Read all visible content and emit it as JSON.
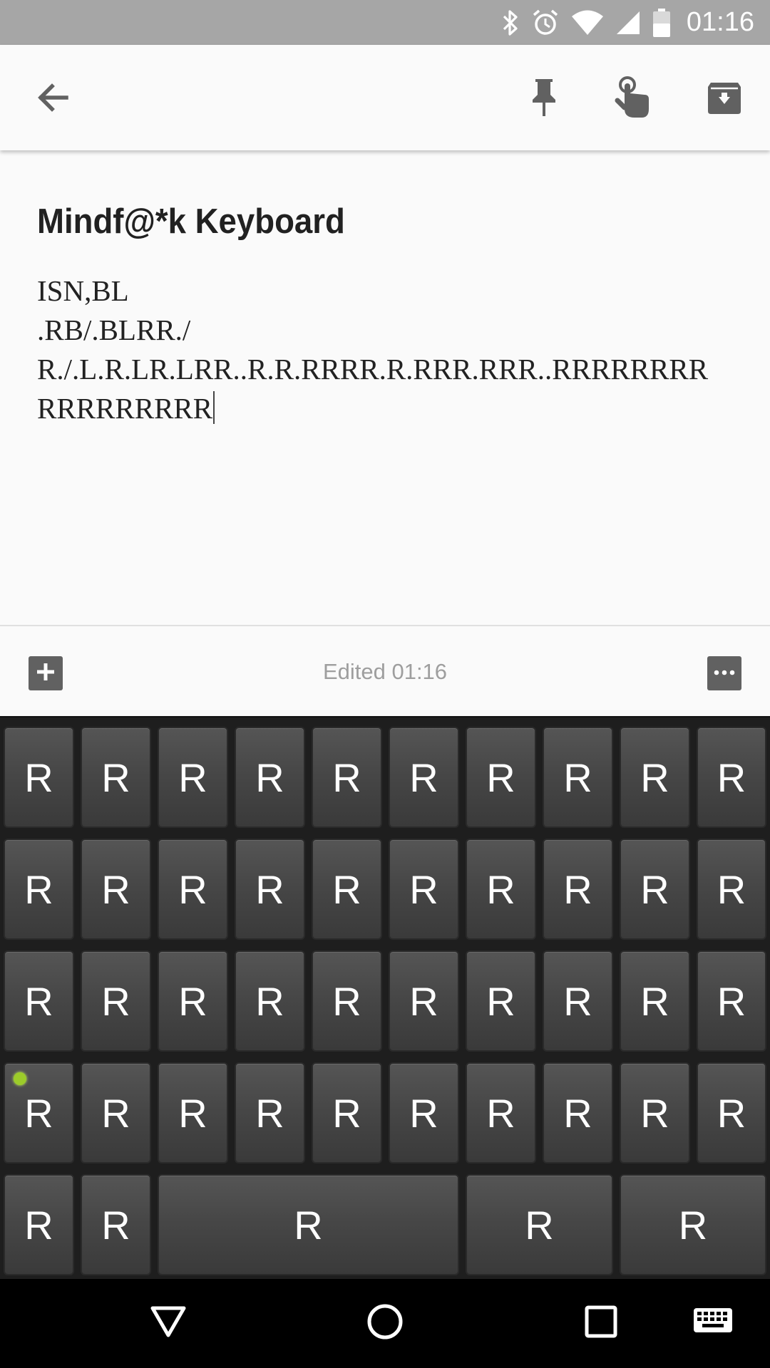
{
  "status_bar": {
    "time": "01:16",
    "battery_level": "48",
    "icons": [
      "bluetooth-icon",
      "alarm-icon",
      "wifi-icon",
      "cell-signal-icon",
      "battery-icon"
    ]
  },
  "toolbar": {
    "icons": [
      "back-arrow-icon",
      "pin-icon",
      "reminder-hand-icon",
      "archive-icon"
    ]
  },
  "note": {
    "title": "Mindf@*k Keyboard",
    "lines": [
      "ISN,BL",
      ".RB/.BLRR./",
      "R./.L.R.LR.LRR..R.R.RRRR.R.RRR.RRR..RRRRRRRR",
      "RRRRRRRRR"
    ]
  },
  "bottom_bar": {
    "edited": "Edited 01:16",
    "icons": [
      "add-box-icon",
      "more-icon"
    ]
  },
  "keyboard": {
    "rows": [
      [
        "R",
        "R",
        "R",
        "R",
        "R",
        "R",
        "R",
        "R",
        "R",
        "R"
      ],
      [
        "R",
        "R",
        "R",
        "R",
        "R",
        "R",
        "R",
        "R",
        "R",
        "R"
      ],
      [
        "R",
        "R",
        "R",
        "R",
        "R",
        "R",
        "R",
        "R",
        "R",
        "R"
      ],
      [
        "R",
        "R",
        "R",
        "R",
        "R",
        "R",
        "R",
        "R",
        "R",
        "R"
      ],
      [
        "R",
        "R",
        "R",
        "R",
        "R"
      ]
    ],
    "indicator_color": "#9ccc2a"
  },
  "nav_bar": {
    "icons": [
      "back-triangle-icon",
      "home-circle-icon",
      "recents-square-icon",
      "keyboard-icon"
    ]
  }
}
